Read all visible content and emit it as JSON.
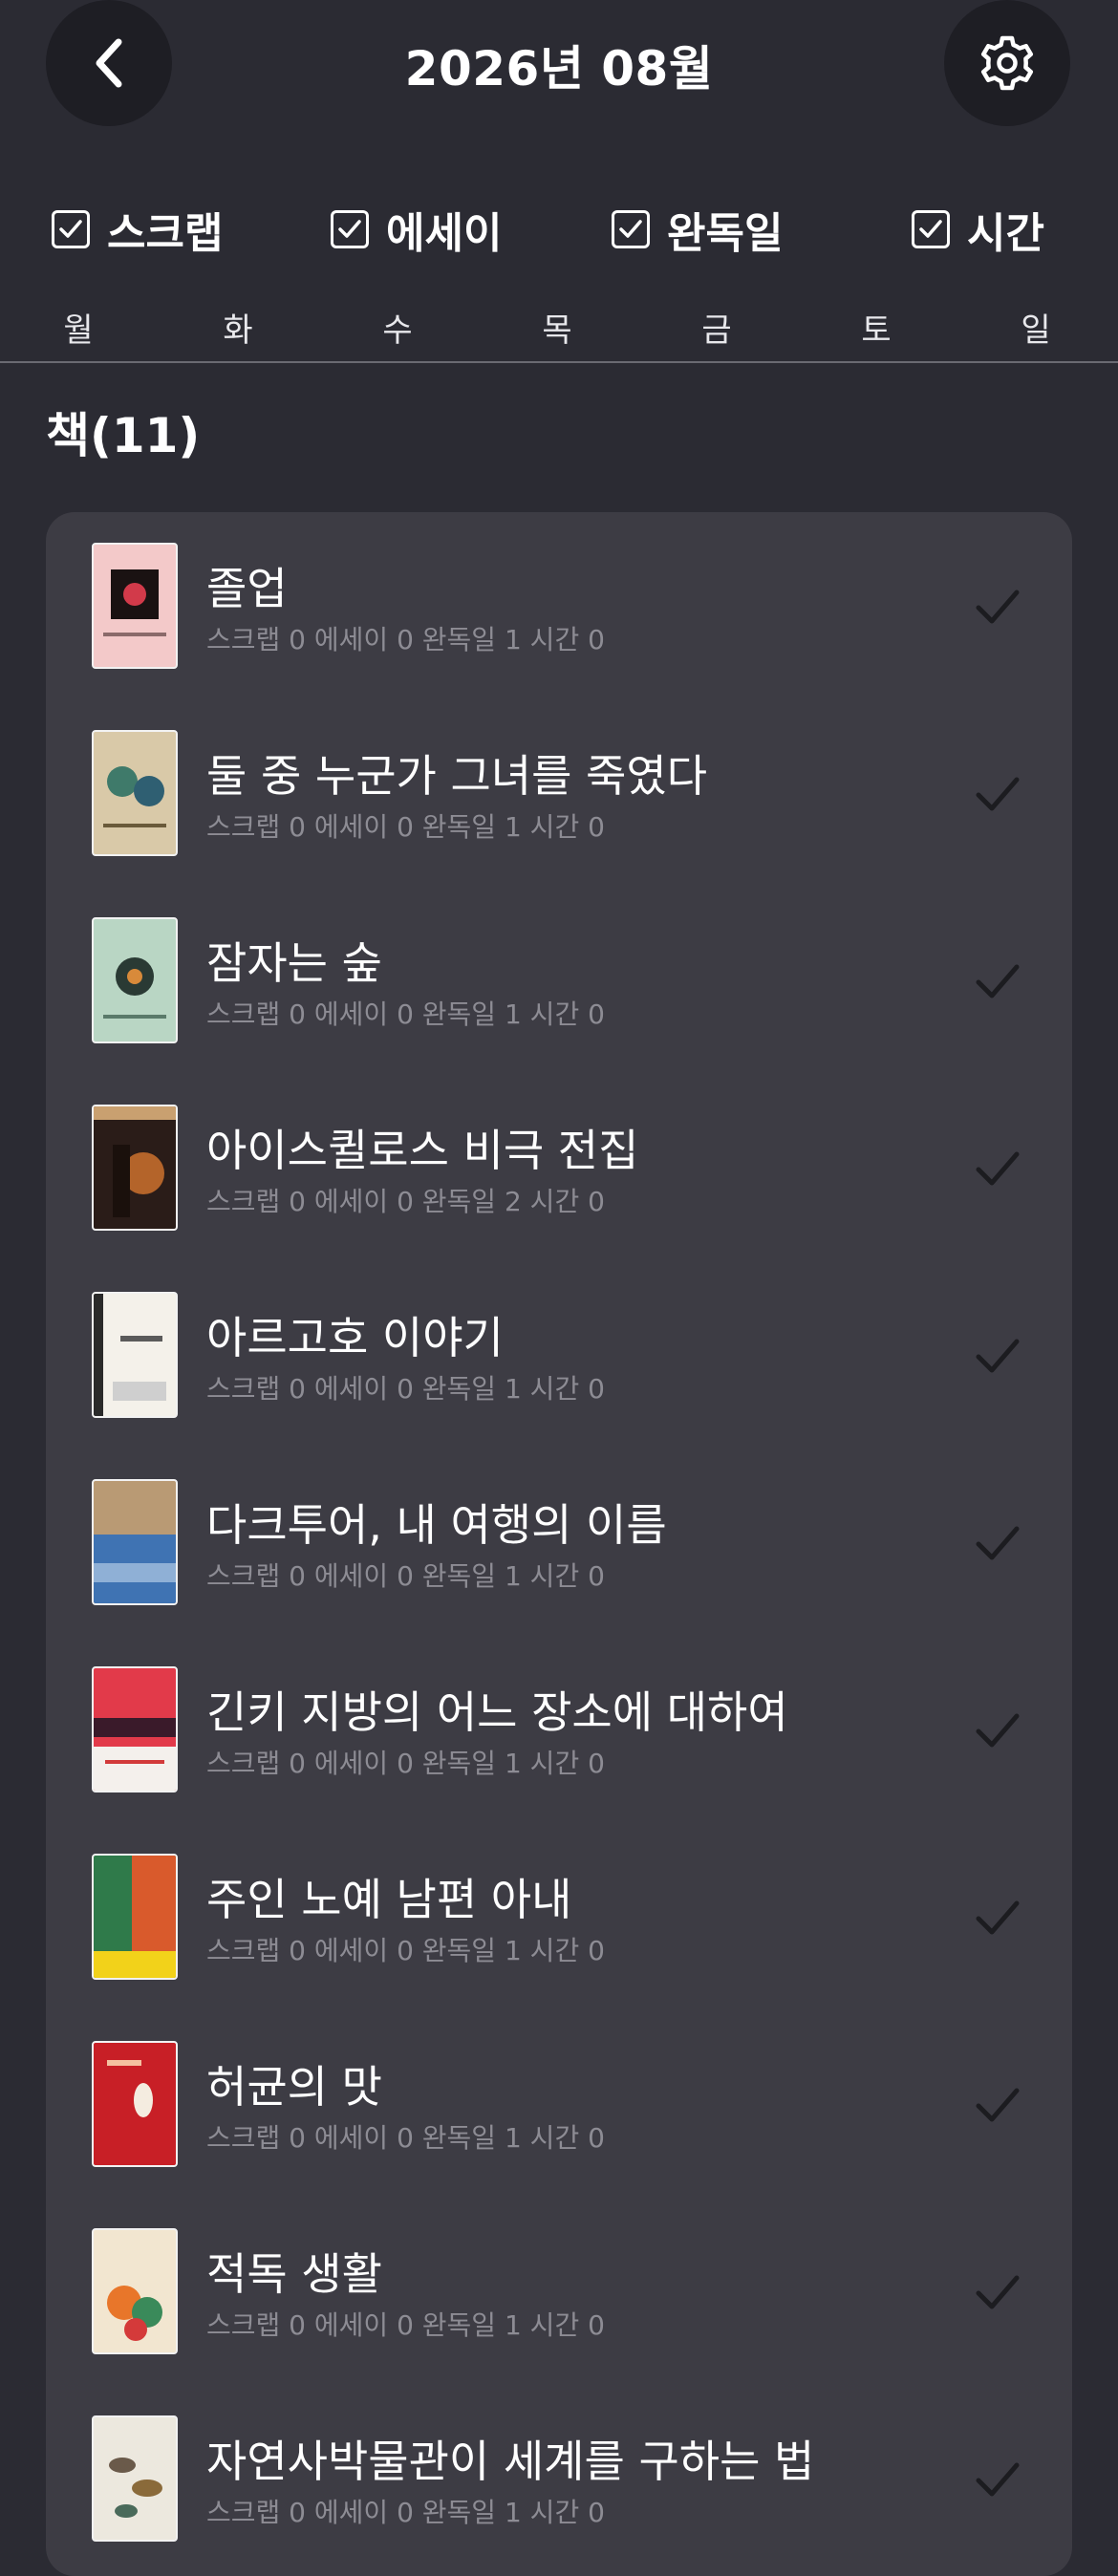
{
  "header": {
    "title": "2026년 08월",
    "back_icon": "chevron-left-icon",
    "settings_icon": "gear-icon"
  },
  "filters": [
    {
      "label": "스크랩",
      "checked": true
    },
    {
      "label": "에세이",
      "checked": true
    },
    {
      "label": "완독일",
      "checked": true
    },
    {
      "label": "시간",
      "checked": true
    }
  ],
  "weekdays": [
    "월",
    "화",
    "수",
    "목",
    "금",
    "토",
    "일"
  ],
  "section": {
    "title": "책(11)"
  },
  "books": [
    {
      "title": "졸업",
      "stats": "스크랩 0 에세이 0 완독일 1 시간 0",
      "cover_color": "#f3c9c9"
    },
    {
      "title": "둘 중 누군가 그녀를 죽였다",
      "stats": "스크랩 0 에세이 0 완독일 1 시간 0",
      "cover_color": "#d9c9a8"
    },
    {
      "title": "잠자는 숲",
      "stats": "스크랩 0 에세이 0 완독일 1 시간 0",
      "cover_color": "#b9d6c4"
    },
    {
      "title": "아이스퀼로스 비극 전집",
      "stats": "스크랩 0 에세이 0 완독일 2 시간 0",
      "cover_color": "#2a1c18"
    },
    {
      "title": "아르고호 이야기",
      "stats": "스크랩 0 에세이 0 완독일 1 시간 0",
      "cover_color": "#f4f1ea"
    },
    {
      "title": "다크투어, 내 여행의 이름",
      "stats": "스크랩 0 에세이 0 완독일 1 시간 0",
      "cover_color": "#3f73b3"
    },
    {
      "title": "긴키 지방의 어느 장소에 대하여",
      "stats": "스크랩 0 에세이 0 완독일 1 시간 0",
      "cover_color": "#e23a4a"
    },
    {
      "title": "주인 노예 남편 아내",
      "stats": "스크랩 0 에세이 0 완독일 1 시간 0",
      "cover_color": "#d95a2c"
    },
    {
      "title": "허균의 맛",
      "stats": "스크랩 0 에세이 0 완독일 1 시간 0",
      "cover_color": "#c81f26"
    },
    {
      "title": "적독 생활",
      "stats": "스크랩 0 에세이 0 완독일 1 시간 0",
      "cover_color": "#f2e6d0"
    },
    {
      "title": "자연사박물관이 세계를 구하는 법",
      "stats": "스크랩 0 에세이 0 완독일 1 시간 0",
      "cover_color": "#ece8de"
    }
  ]
}
